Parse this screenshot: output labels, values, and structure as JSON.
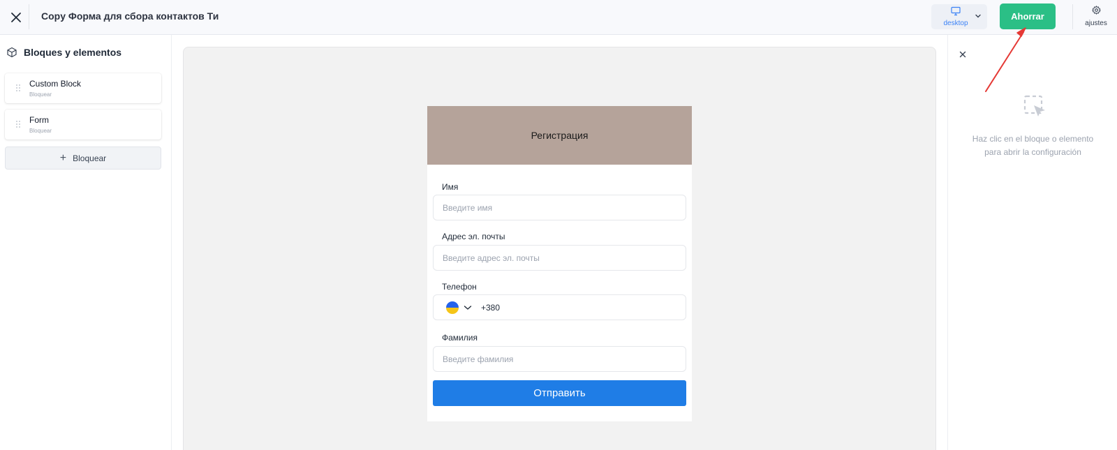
{
  "topbar": {
    "title": "Copy Форма для сбора контактов Ти",
    "device_label": "desktop",
    "save_label": "Ahorrar",
    "settings_label": "ajustes"
  },
  "sidebar": {
    "title": "Bloques y elementos",
    "blocks": [
      {
        "name": "Custom Block",
        "sub": "Bloquear"
      },
      {
        "name": "Form",
        "sub": "Bloquear"
      }
    ],
    "add_label": "Bloquear"
  },
  "form": {
    "header": "Регистрация",
    "fields": [
      {
        "label": "Имя",
        "placeholder": "Введите имя"
      },
      {
        "label": "Адрес эл. почты",
        "placeholder": "Введите адрес эл. почты"
      },
      {
        "label": "Телефон",
        "value": "+380"
      },
      {
        "label": "Фамилия",
        "placeholder": "Введите фамилия"
      }
    ],
    "submit_label": "Отправить"
  },
  "right_panel": {
    "hint_line1": "Haz clic en el bloque o elemento",
    "hint_line2": "para abrir la configuración"
  },
  "colors": {
    "save": "#2bbf86",
    "submit": "#1f7de6",
    "form_header": "#b5a39a",
    "annotation": "#e53935"
  }
}
